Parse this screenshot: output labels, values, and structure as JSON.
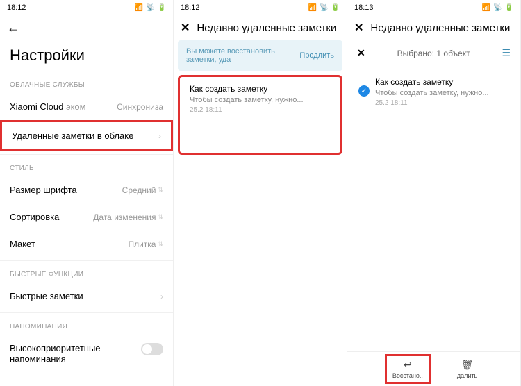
{
  "screen1": {
    "time": "18:12",
    "title": "Настройки",
    "sections": {
      "cloud": {
        "label": "ОБЛАЧНЫЕ СЛУЖБЫ",
        "xiaomi_label": "Xiaomi Cloud",
        "xiaomi_suffix": "эком",
        "xiaomi_value": "Синхрониза",
        "deleted_label": "Удаленные заметки в облаке"
      },
      "style": {
        "label": "СТИЛЬ",
        "font_label": "Размер шрифта",
        "font_value": "Средний",
        "sort_label": "Сортировка",
        "sort_value": "Дата изменения",
        "layout_label": "Макет",
        "layout_value": "Плитка"
      },
      "quick": {
        "label": "БЫСТРЫЕ ФУНКЦИИ",
        "item_label": "Быстрые заметки"
      },
      "reminders": {
        "label": "НАПОМИНАНИЯ",
        "item_label": "Высокоприоритетные напоминания"
      }
    }
  },
  "screen2": {
    "time": "18:12",
    "header": "Недавно удаленные заметки",
    "banner_text": "Вы можете восстановить заметки, уда",
    "banner_action": "Продлить",
    "note": {
      "title": "Как создать заметку",
      "preview": "Чтобы создать заметку, нужно...",
      "date": "25.2 18:11"
    }
  },
  "screen3": {
    "time": "18:13",
    "header": "Недавно удаленные заметки",
    "selection_text": "Выбрано: 1 объект",
    "note": {
      "title": "Как создать заметку",
      "preview": "Чтобы создать заметку, нужно...",
      "date": "25.2 18:11"
    },
    "restore_label": "Восстано..",
    "delete_label": "далить "
  }
}
